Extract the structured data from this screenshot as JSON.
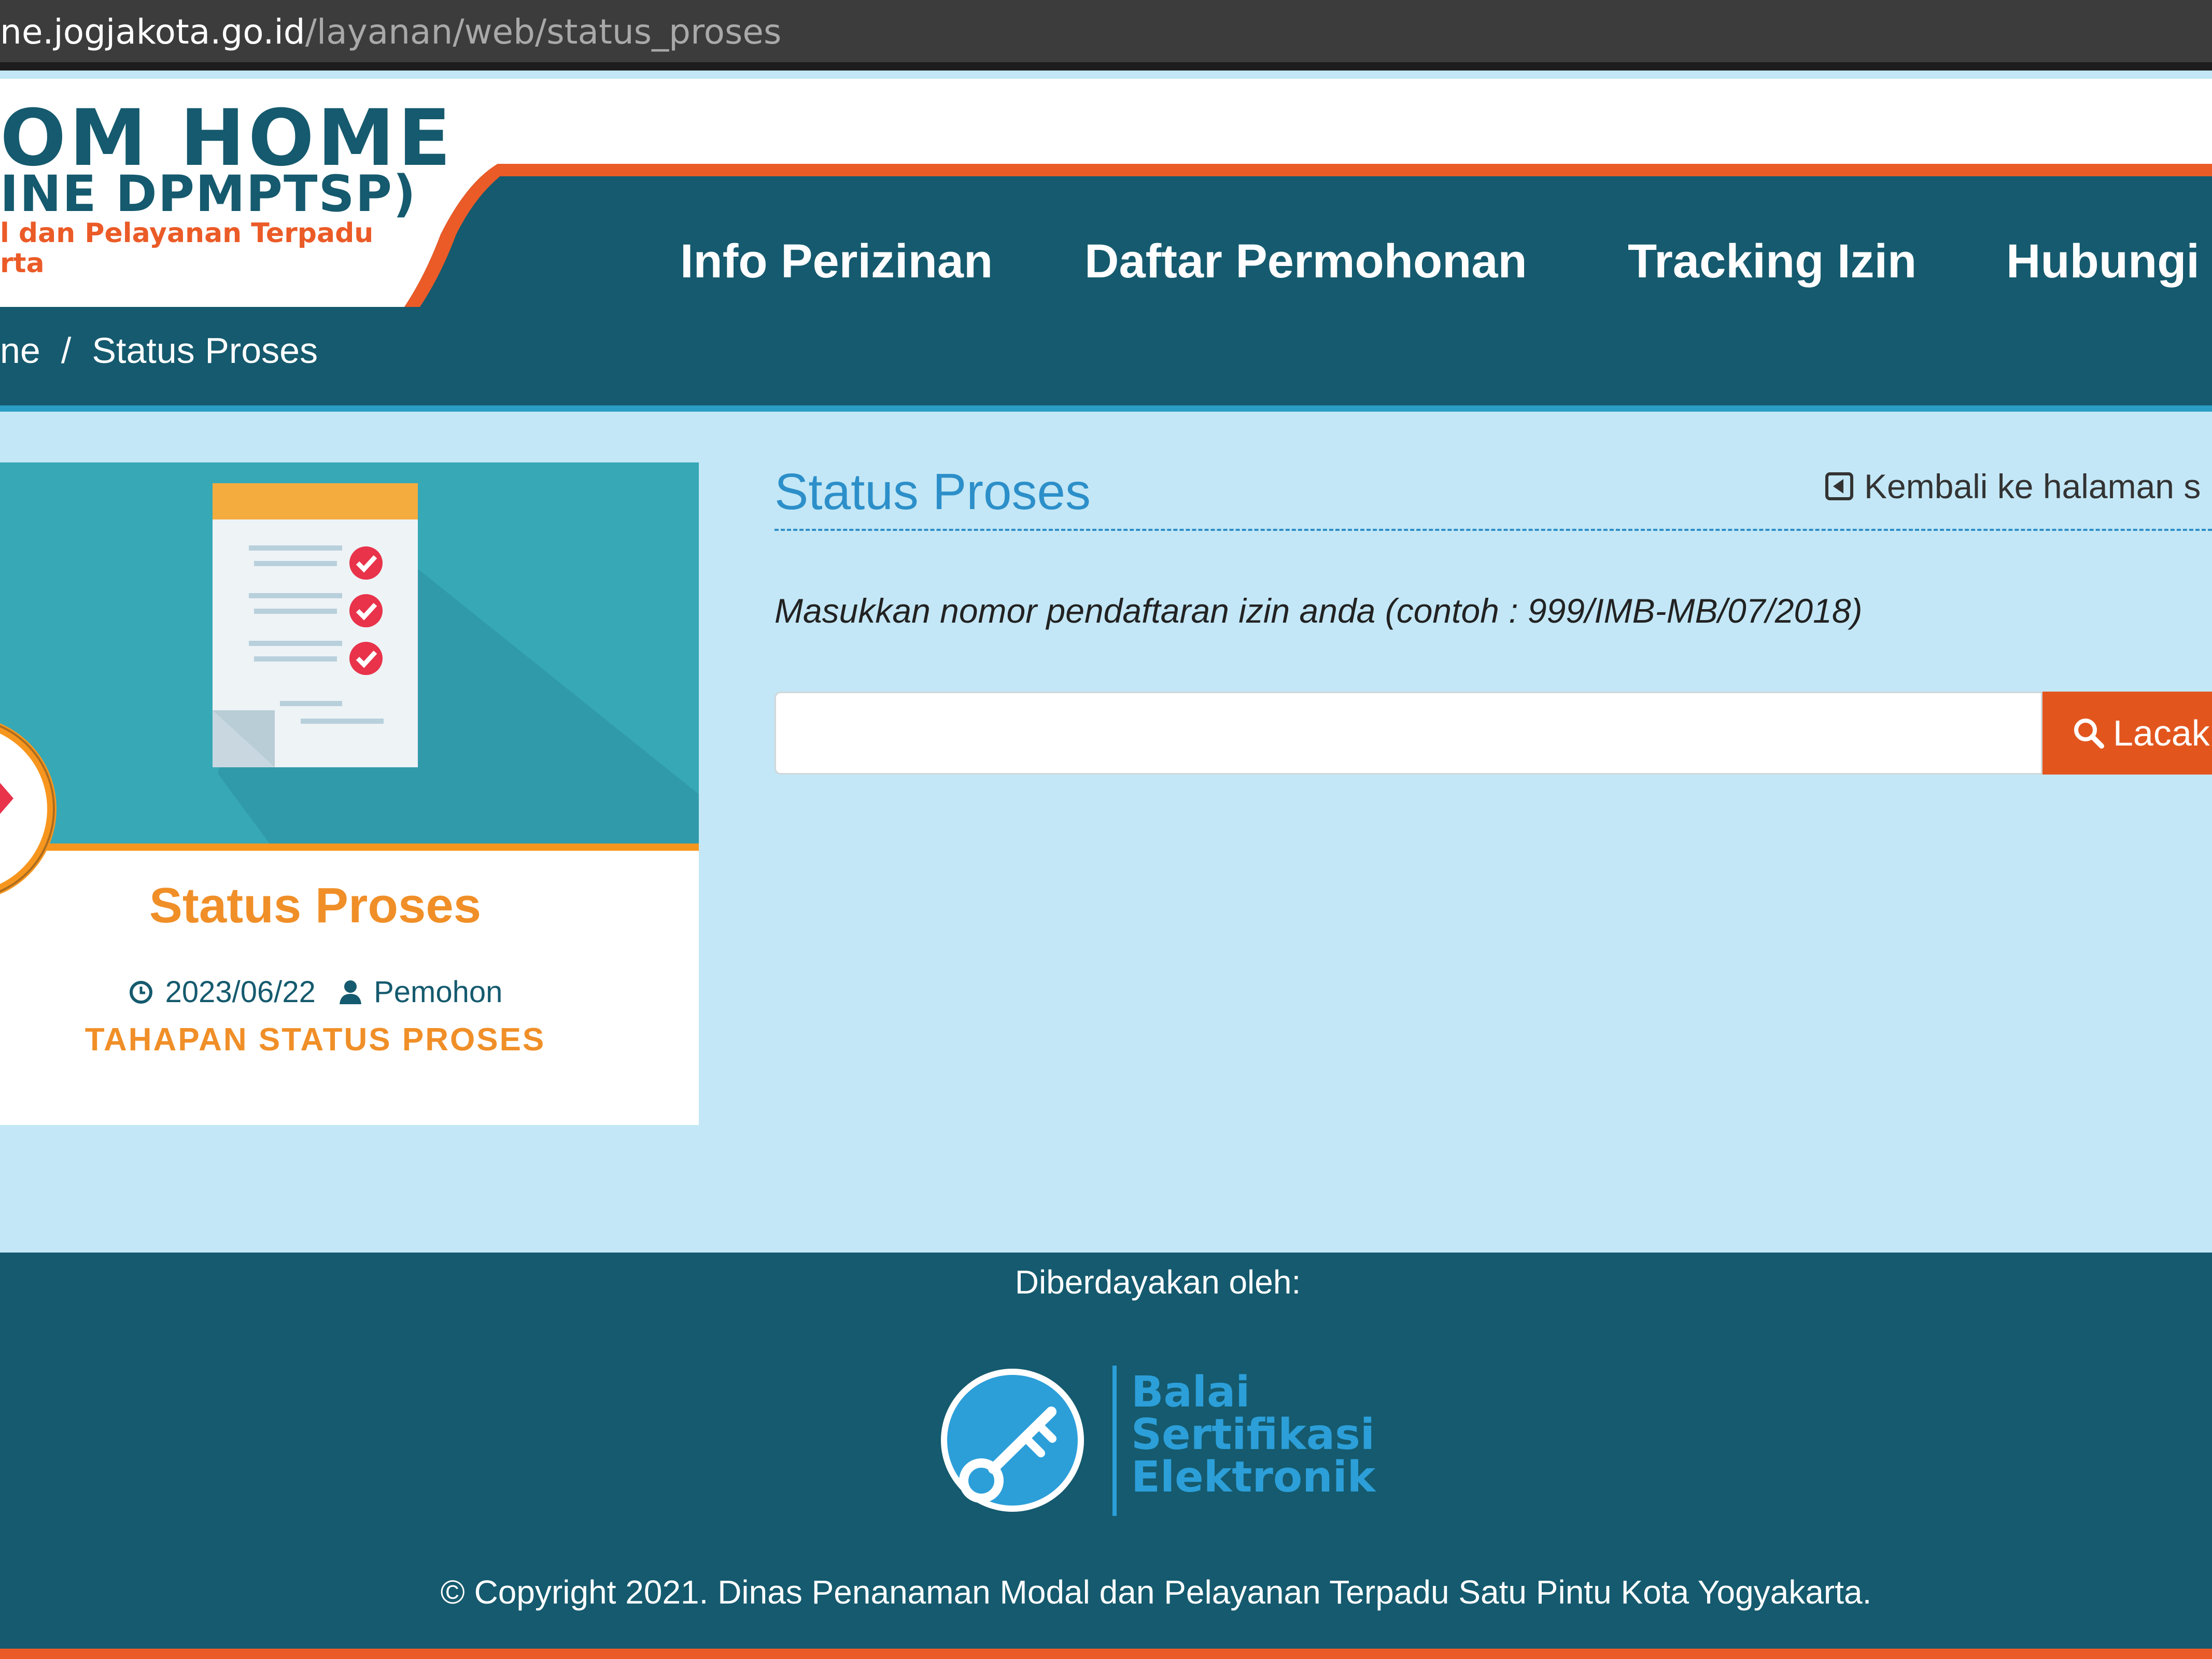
{
  "browser": {
    "url_host": "ne.jogjakota.go.id",
    "url_path": "/layanan/web/status_proses"
  },
  "logo": {
    "title": "OM HOME",
    "subtitle": "INE DPMPTSP)",
    "tagline_1": "l dan Pelayanan Terpadu",
    "tagline_2": "rta"
  },
  "nav": {
    "items": [
      {
        "label": "Info Perizinan"
      },
      {
        "label": "Daftar Permohonan"
      },
      {
        "label": "Tracking Izin"
      },
      {
        "label": "Hubungi"
      }
    ]
  },
  "breadcrumb": {
    "home": "ne",
    "separator": "/",
    "current": "Status Proses"
  },
  "card": {
    "title": "Status Proses",
    "date": "2023/06/22",
    "author": "Pemohon",
    "link": "TAHAPAN STATUS PROSES",
    "icons": {
      "date": "clock-icon",
      "author": "user-icon"
    }
  },
  "main": {
    "title": "Status Proses",
    "back_link": "Kembali ke halaman s",
    "instruction": "Masukkan nomor pendaftaran izin anda (contoh : 999/IMB-MB/07/2018)",
    "search": {
      "value": "",
      "button_label": "Lacak"
    }
  },
  "footer": {
    "powered_by": "Diberdayakan oleh:",
    "bsre_lines": [
      "Balai",
      "Sertifikasi",
      "Elektronik"
    ],
    "copyright": "© Copyright 2021. Dinas Penanaman Modal dan Pelayanan Terpadu Satu Pintu Kota Yogyakarta."
  },
  "colors": {
    "primary": "#155a6e",
    "accent": "#eb5b27",
    "orange_text": "#f08f28",
    "link_blue": "#2c8fc9",
    "content_bg": "#c3e7f6"
  }
}
